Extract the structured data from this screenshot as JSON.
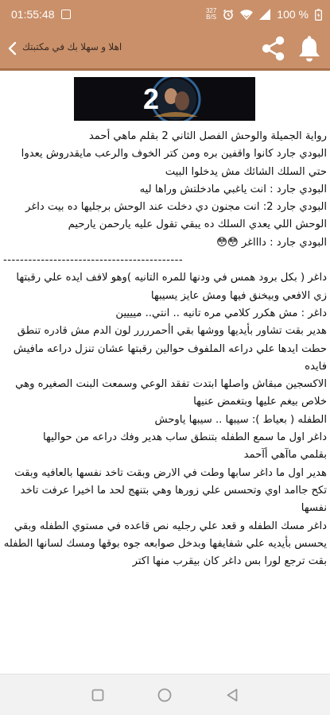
{
  "status_bar": {
    "time": "01:55:48",
    "net_speed_value": "327",
    "net_speed_unit": "B/S",
    "battery": "100 %"
  },
  "app_bar": {
    "title": "اهلا و سهلا بك في مكتبتك"
  },
  "banner": {
    "number": "2"
  },
  "article": {
    "paragraphs": [
      "رواية الجميلة والوحش الفصل الثاني 2 بقلم ماهي أحمد",
      "البودي جارد كانوا واقفين بره ومن كتر الخوف والرعب مايقدروش يعدوا حتي السلك الشائك مش يدخلوا البيت",
      "البودي جارد : انت ياغبي مادخلتش وراها ليه",
      "البودي جارد 2: انت مجنون دي دخلت عند الوحش برجليها ده بيت داغر الوحش اللي يعدي السلك ده يبقي تقول عليه يارحمن يارحيم",
      "البودي جارد : داااغر 😳😳",
      "-------------------------------------------",
      "داغر ( بكل برود همس في ودنها للمره التانيه )وهو لافف ايده علي رقبتها زي الافعي وبيخنق فيها ومش عايز يسيبها",
      "داغر : مش هكرر كلامي مره تانيه .. انتي.. ميييين",
      "هدير بقت تشاور بأيديها ووشها بقي اأحمرررر لون الدم مش قادره تنطق حطت ايدها علي دراعه الملفوف حوالين رقبتها عشان تنزل دراعه مافيش فايده",
      "الاكسجين مبقاش واصلها ابتدت تفقد الوعي وسمعت البنت الصغيره وهي خلاص بيغم عليها وبتغمض عنيها",
      "الطفله ( بعياط ): سيبها .. سيبها ياوحش",
      "داغر اول ما سمع الطفله بتنطق ساب هدير وفك دراعه من حواليها",
      "بقلمي ماآهي أآحمد",
      "هدير اول ما داغر سابها وطت في الارض وبقت تاخد نفسها بالعافيه وبقت تكح جاامد اوي وتحسس علي زورها وهي بتنهج لحد ما اخيرا عرفت تاخد نفسها",
      "داغر مسك الطفله و قعد علي رجليه نص قاعده في مستوي الطفله وبقي يحسس بأيديه علي شفايفها وبدخل صوابعه جوه بوقها ومسك لسانها الطفله بقت ترجع لورا بس داغر كان بيقرب منها اكتر"
    ]
  }
}
